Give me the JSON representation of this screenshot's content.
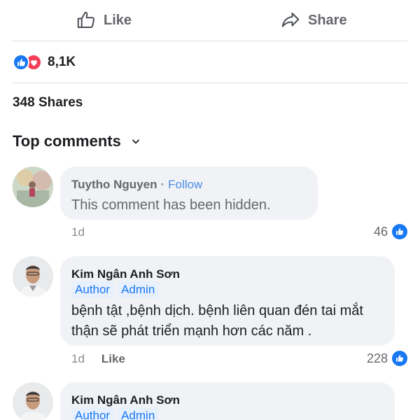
{
  "actions": {
    "like_label": "Like",
    "share_label": "Share"
  },
  "reactions": {
    "count": "8,1K",
    "icons": [
      "like-icon",
      "love-icon"
    ]
  },
  "shares": "348 Shares",
  "top_comments": {
    "label": "Top comments"
  },
  "comments": [
    {
      "author": "Tuytho Nguyen",
      "separator": "·",
      "follow": "Follow",
      "text": "This comment has been hidden.",
      "time": "1d",
      "likes": "46"
    },
    {
      "author": "Kim Ngân Anh Sơn",
      "badges": [
        "Author",
        "Admin"
      ],
      "text": "bệnh tật ,bệnh dịch. bệnh liên quan đén tai mắt thận sẽ phát triển mạnh hơn các năm .",
      "time": "1d",
      "like_label": "Like",
      "likes": "228"
    },
    {
      "author": "Kim Ngân Anh Sơn",
      "badges": [
        "Author",
        "Admin"
      ]
    }
  ],
  "colors": {
    "accent": "#1877f2",
    "love": "#f33e58",
    "bubble": "#f0f2f5",
    "muted": "#65676b"
  }
}
